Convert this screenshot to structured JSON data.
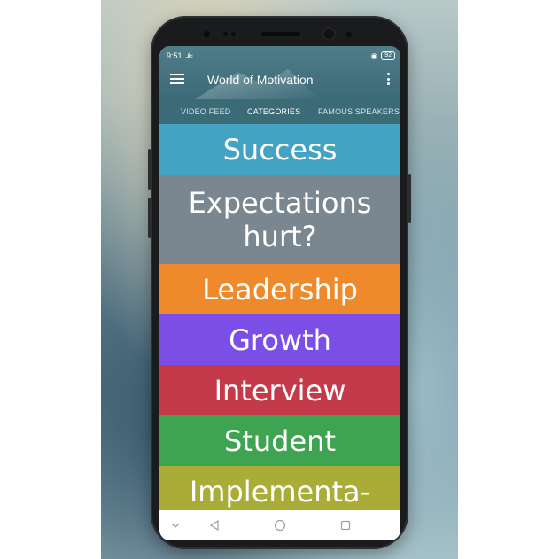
{
  "status_bar": {
    "time": "9:51",
    "signal": "..ıl",
    "wifi": "≈",
    "battery": "92"
  },
  "app_bar": {
    "title": "World of Motivation"
  },
  "tabs": [
    {
      "label": "VIDEO FEED",
      "active": false
    },
    {
      "label": "CATEGORIES",
      "active": true
    },
    {
      "label": "FAMOUS SPEAKERS",
      "active": false
    }
  ],
  "categories": [
    {
      "label": "Success",
      "color": "#44a2c2"
    },
    {
      "label": "Expectations hurt?",
      "color": "#7b8790"
    },
    {
      "label": "Leadership",
      "color": "#ee8a2c"
    },
    {
      "label": "Growth",
      "color": "#7c4ee8"
    },
    {
      "label": "Interview",
      "color": "#c43a4a"
    },
    {
      "label": "Student",
      "color": "#3fa452"
    },
    {
      "label": "Implementa-",
      "color": "#a9ad38"
    }
  ],
  "nav_bar": {
    "icons": [
      "chevron-down-icon",
      "back-icon",
      "home-icon",
      "recents-icon"
    ]
  }
}
